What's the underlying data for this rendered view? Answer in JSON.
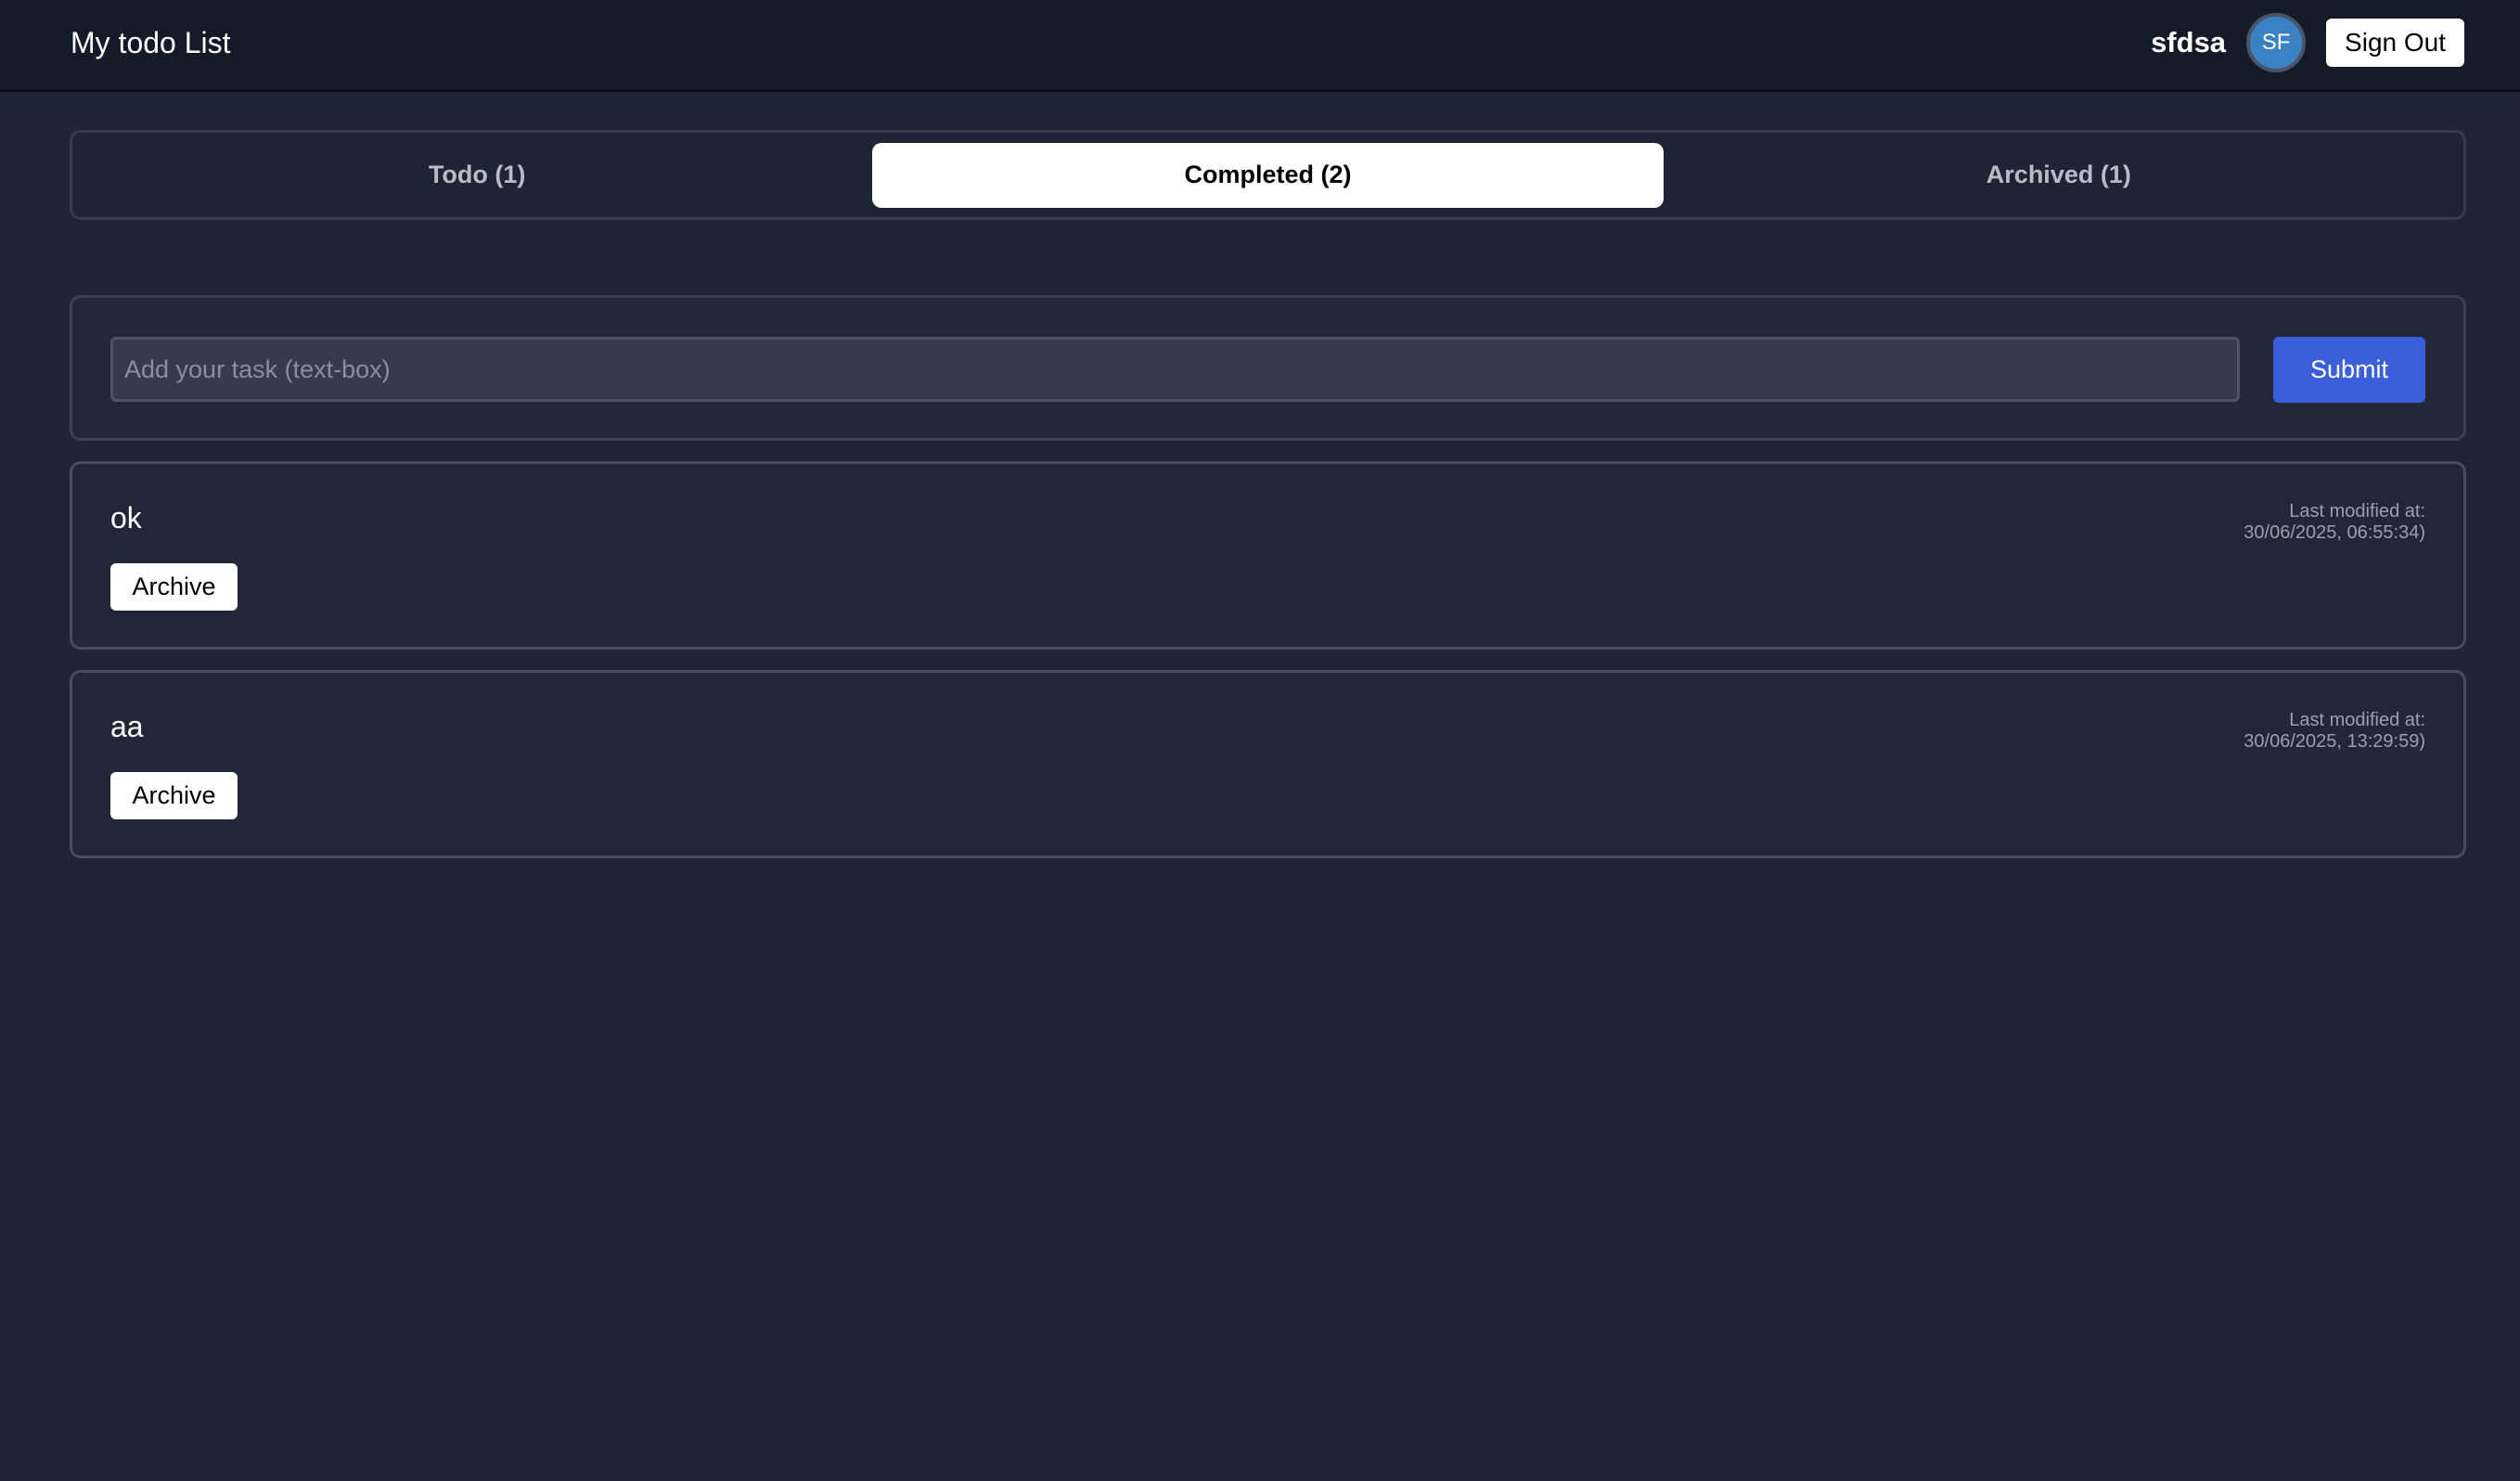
{
  "header": {
    "title": "My todo List",
    "username": "sfdsa",
    "avatar_initials": "SF",
    "signout_label": "Sign Out"
  },
  "tabs": [
    {
      "label": "Todo (1)",
      "active": false
    },
    {
      "label": "Completed (2)",
      "active": true
    },
    {
      "label": "Archived (1)",
      "active": false
    }
  ],
  "add_task": {
    "placeholder": "Add your task (text-box)",
    "value": "",
    "submit_label": "Submit"
  },
  "tasks": [
    {
      "text": "ok",
      "modified_label": "Last modified at:",
      "modified_value": "30/06/2025, 06:55:34)",
      "archive_label": "Archive"
    },
    {
      "text": "aa",
      "modified_label": "Last modified at:",
      "modified_value": "30/06/2025, 13:29:59)",
      "archive_label": "Archive"
    }
  ],
  "colors": {
    "background": "#202535",
    "header_bg": "#151a29",
    "accent": "#3b5fd9",
    "avatar": "#3b82c4"
  }
}
